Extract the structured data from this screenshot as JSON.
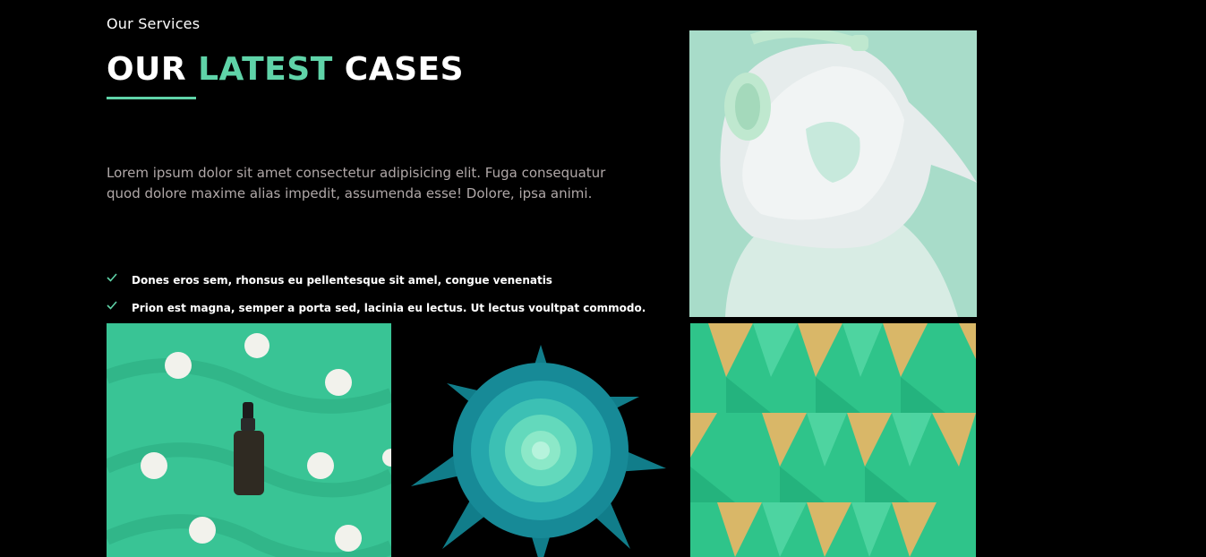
{
  "section": {
    "eyebrow": "Our Services",
    "heading": {
      "part1": "OUR",
      "accent": "LATEST",
      "part2": "CASES"
    },
    "description": "Lorem ipsum dolor sit amet consectetur adipisicing elit. Fuga consequatur quod dolore maxime alias impedit, assumenda esse! Dolore, ipsa animi.",
    "checklist": [
      "Dones eros sem, rhonsus eu pellentesque sit amel, congue venenatis",
      "Prion est magna, semper a porta sed, lacinia eu lectus. Ut lectus voultpat commodo."
    ]
  },
  "colors": {
    "accent": "#5fd3a8",
    "background": "#000000",
    "muted_text": "#b0a8a8"
  },
  "gallery": [
    {
      "name": "headphones-girl-image"
    },
    {
      "name": "bottle-pearls-image"
    },
    {
      "name": "paper-flower-image"
    },
    {
      "name": "geometric-pattern-image"
    }
  ]
}
